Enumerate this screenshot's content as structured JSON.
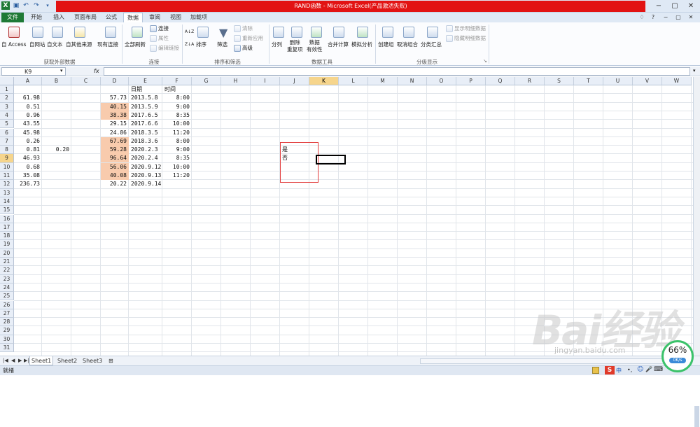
{
  "window": {
    "title": "RAND函数 - Microsoft Excel(产品激活失败)",
    "qat_icons": [
      "excel-icon",
      "save-icon",
      "undo-icon",
      "redo-icon",
      "customize-icon"
    ],
    "controls": [
      "−",
      "▢",
      "✕"
    ],
    "ribbon_controls": [
      "♢",
      "?",
      "−",
      "▢",
      "✕"
    ]
  },
  "tabs": [
    "文件",
    "开始",
    "插入",
    "页面布局",
    "公式",
    "数据",
    "审阅",
    "视图",
    "加载项"
  ],
  "active_tab": "数据",
  "ribbon": {
    "groups": [
      {
        "label": "获取外部数据",
        "buttons": [
          "自 Access",
          "自网站",
          "自文本",
          "自其他来源",
          "现有连接"
        ]
      },
      {
        "label": "连接",
        "main": "全部刷新",
        "small": [
          "连接",
          "属性",
          "编辑链接"
        ]
      },
      {
        "label": "排序和筛选",
        "buttons": [
          "排序",
          "筛选"
        ],
        "small": [
          "清除",
          "重新应用",
          "高级"
        ]
      },
      {
        "label": "数据工具",
        "buttons": [
          "分列",
          "删除\n重复项",
          "数据\n有效性",
          "合并计算",
          "模拟分析"
        ]
      },
      {
        "label": "分级显示",
        "buttons": [
          "创建组",
          "取消组合",
          "分类汇总"
        ],
        "small": [
          "显示明细数据",
          "隐藏明细数据"
        ]
      }
    ],
    "az": "A↓Z",
    "za": "Z↓A",
    "filter_icon": "▼",
    "dialog_launcher": "↘"
  },
  "formula_bar": {
    "name_box": "K9",
    "fx": "fx",
    "value": ""
  },
  "columns": [
    "A",
    "B",
    "C",
    "D",
    "E",
    "F",
    "G",
    "H",
    "I",
    "J",
    "K",
    "L",
    "M",
    "N",
    "O",
    "P",
    "Q",
    "R",
    "S",
    "T",
    "U",
    "V",
    "W"
  ],
  "selected_column": "K",
  "rows": [
    "1",
    "2",
    "3",
    "4",
    "5",
    "6",
    "7",
    "8",
    "9",
    "10",
    "11",
    "12",
    "13",
    "14",
    "15",
    "16",
    "17",
    "18",
    "19",
    "20",
    "21",
    "22",
    "23",
    "24",
    "25",
    "26",
    "27",
    "28",
    "29",
    "30",
    "31"
  ],
  "selected_row": "9",
  "cells": {
    "A": [
      "61.98",
      "0.51",
      "0.96",
      "43.55",
      "45.98",
      "0.26",
      "0.81",
      "46.93",
      "0.68",
      "35.08",
      "236.73"
    ],
    "B8": "0.20",
    "D": [
      "57.73",
      "40.15",
      "38.38",
      "29.15",
      "24.86",
      "67.69",
      "59.28",
      "96.64",
      "56.06",
      "40.08",
      "20.22"
    ],
    "E_header": "日期",
    "E": [
      "2013.5.8",
      "2013.5.9",
      "2017.6.5",
      "2017.6.6",
      "2018.3.5",
      "2018.3.6",
      "2020.2.3",
      "2020.2.4",
      "2020.9.12",
      "2020.9.13",
      "2020.9.14"
    ],
    "F_header": "时间",
    "F": [
      "8:00",
      "9:00",
      "8:35",
      "10:00",
      "11:20",
      "8:00",
      "9:00",
      "8:35",
      "10:00",
      "11:20"
    ],
    "J8": "是",
    "J9": "否"
  },
  "sheets": [
    "Sheet1",
    "Sheet2",
    "Sheet3"
  ],
  "active_sheet": "Sheet1",
  "sheet_nav": [
    "|◀",
    "◀",
    "▶",
    "▶|"
  ],
  "status": {
    "text": "就绪"
  },
  "watermark": {
    "text": "Bai经验",
    "url": "jingyan.baidu.com"
  },
  "speed_widget": {
    "percent": "66%",
    "rate": "0K/s"
  },
  "tray": [
    "S",
    "中",
    "•,",
    "☺",
    "🎤",
    "⌨",
    "👕",
    "👤"
  ],
  "colors": {
    "title_bar": "#e21313",
    "file_tab": "#1e7a36",
    "highlight": "#f8cbad",
    "selection": "#f6d58c",
    "red_box": "#e23b3b"
  }
}
